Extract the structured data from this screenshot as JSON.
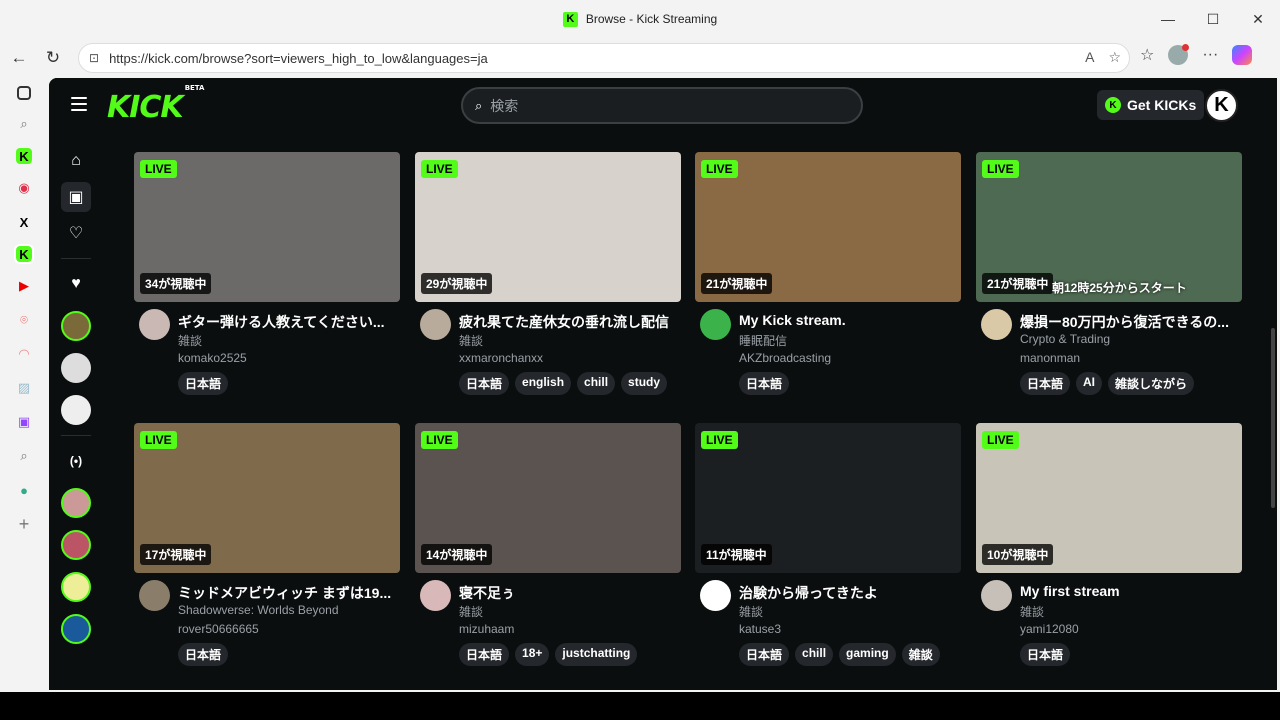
{
  "window": {
    "title": "Browse - Kick Streaming"
  },
  "browser": {
    "url": "https://kick.com/browse?sort=viewers_high_to_low&languages=ja"
  },
  "site": {
    "logo": "KICK",
    "logo_badge": "BETA",
    "search_placeholder": "検索",
    "get_kicks": "Get KICKs"
  },
  "cards": [
    {
      "live": "LIVE",
      "viewers": "34が視聴中",
      "title": "ギター弾ける人教えてください...",
      "category": "雑談",
      "channel": "komako2525",
      "tags": [
        "日本語"
      ],
      "thumb": "#6b6a68",
      "avatar": "#c9b8b3"
    },
    {
      "live": "LIVE",
      "viewers": "29が視聴中",
      "title": "疲れ果てた産休女の垂れ流し配信",
      "category": "雑談",
      "channel": "xxmaronchanxx",
      "tags": [
        "日本語",
        "english",
        "chill",
        "study"
      ],
      "thumb": "#d7d2cb",
      "avatar": "#b9ab9b"
    },
    {
      "live": "LIVE",
      "viewers": "21が視聴中",
      "title": "My Kick stream.",
      "category": "睡眠配信",
      "channel": "AKZbroadcasting",
      "tags": [
        "日本語"
      ],
      "thumb": "#8a6a44",
      "avatar": "#3bb34a"
    },
    {
      "live": "LIVE",
      "viewers": "21が視聴中",
      "overlay": "朝12時25分からスタート",
      "title": "爆損ー80万円から復活できるの...",
      "category": "Crypto & Trading",
      "channel": "manonman",
      "tags": [
        "日本語",
        "AI",
        "雑談しながら"
      ],
      "thumb": "#4f6a52",
      "avatar": "#d9c9a6"
    },
    {
      "live": "LIVE",
      "viewers": "17が視聴中",
      "title": "ミッドメアビウィッチ まずは19...",
      "category": "Shadowverse: Worlds Beyond",
      "channel": "rover50666665",
      "tags": [
        "日本語"
      ],
      "thumb": "#7f6a4c",
      "avatar": "#8a7e6a"
    },
    {
      "live": "LIVE",
      "viewers": "14が視聴中",
      "title": "寝不足ぅ",
      "category": "雑談",
      "channel": "mizuhaam",
      "tags": [
        "日本語",
        "18+",
        "justchatting"
      ],
      "thumb": "#5a5350",
      "avatar": "#d8b8b8"
    },
    {
      "live": "LIVE",
      "viewers": "11が視聴中",
      "title": "治験から帰ってきたよ",
      "category": "雑談",
      "channel": "katuse3",
      "tags": [
        "日本語",
        "chill",
        "gaming",
        "雑談"
      ],
      "thumb": "#1c1f22",
      "avatar": "#ffffff"
    },
    {
      "live": "LIVE",
      "viewers": "10が視聴中",
      "title": "My first stream",
      "category": "雑談",
      "channel": "yami12080",
      "tags": [
        "日本語"
      ],
      "thumb": "#c9c4b8",
      "avatar": "#c7c0b8"
    }
  ]
}
